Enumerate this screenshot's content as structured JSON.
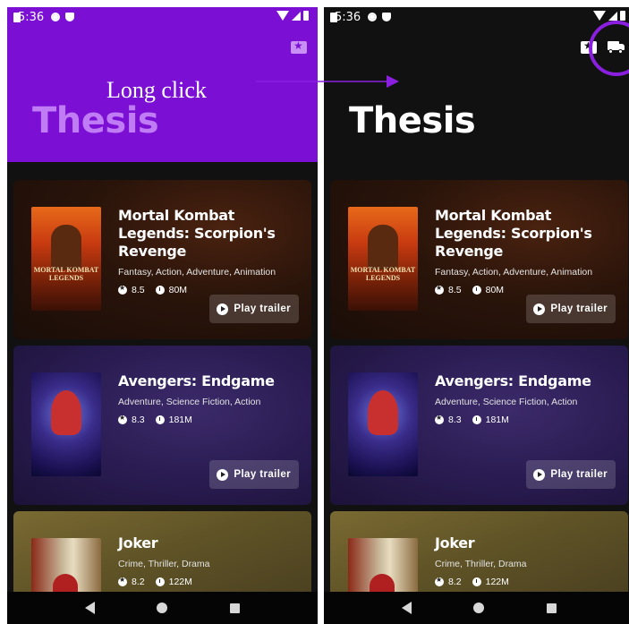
{
  "status": {
    "time": "5:36"
  },
  "app": {
    "title": "Thesis"
  },
  "annotation": {
    "label": "Long click",
    "color": "#8a1fe0"
  },
  "colors": {
    "appbar_left": "#7b0fd4",
    "appbar_right": "#111111"
  },
  "icons": {
    "ticket": "ticket-star-icon",
    "truck": "truck-icon",
    "rating": "star-icon",
    "duration": "clock-icon",
    "play": "play-icon"
  },
  "movies": [
    {
      "title": "Mortal Kombat Legends: Scorpion's Revenge",
      "genres": "Fantasy, Action, Adventure, Animation",
      "rating": "8.5",
      "duration": "80M",
      "trailer": "Play trailer",
      "poster_text": "MORTAL KOMBAT LEGENDS"
    },
    {
      "title": "Avengers: Endgame",
      "genres": "Adventure, Science Fiction, Action",
      "rating": "8.3",
      "duration": "181M",
      "trailer": "Play trailer"
    },
    {
      "title": "Joker",
      "genres": "Crime, Thriller, Drama",
      "rating": "8.2",
      "duration": "122M"
    }
  ]
}
